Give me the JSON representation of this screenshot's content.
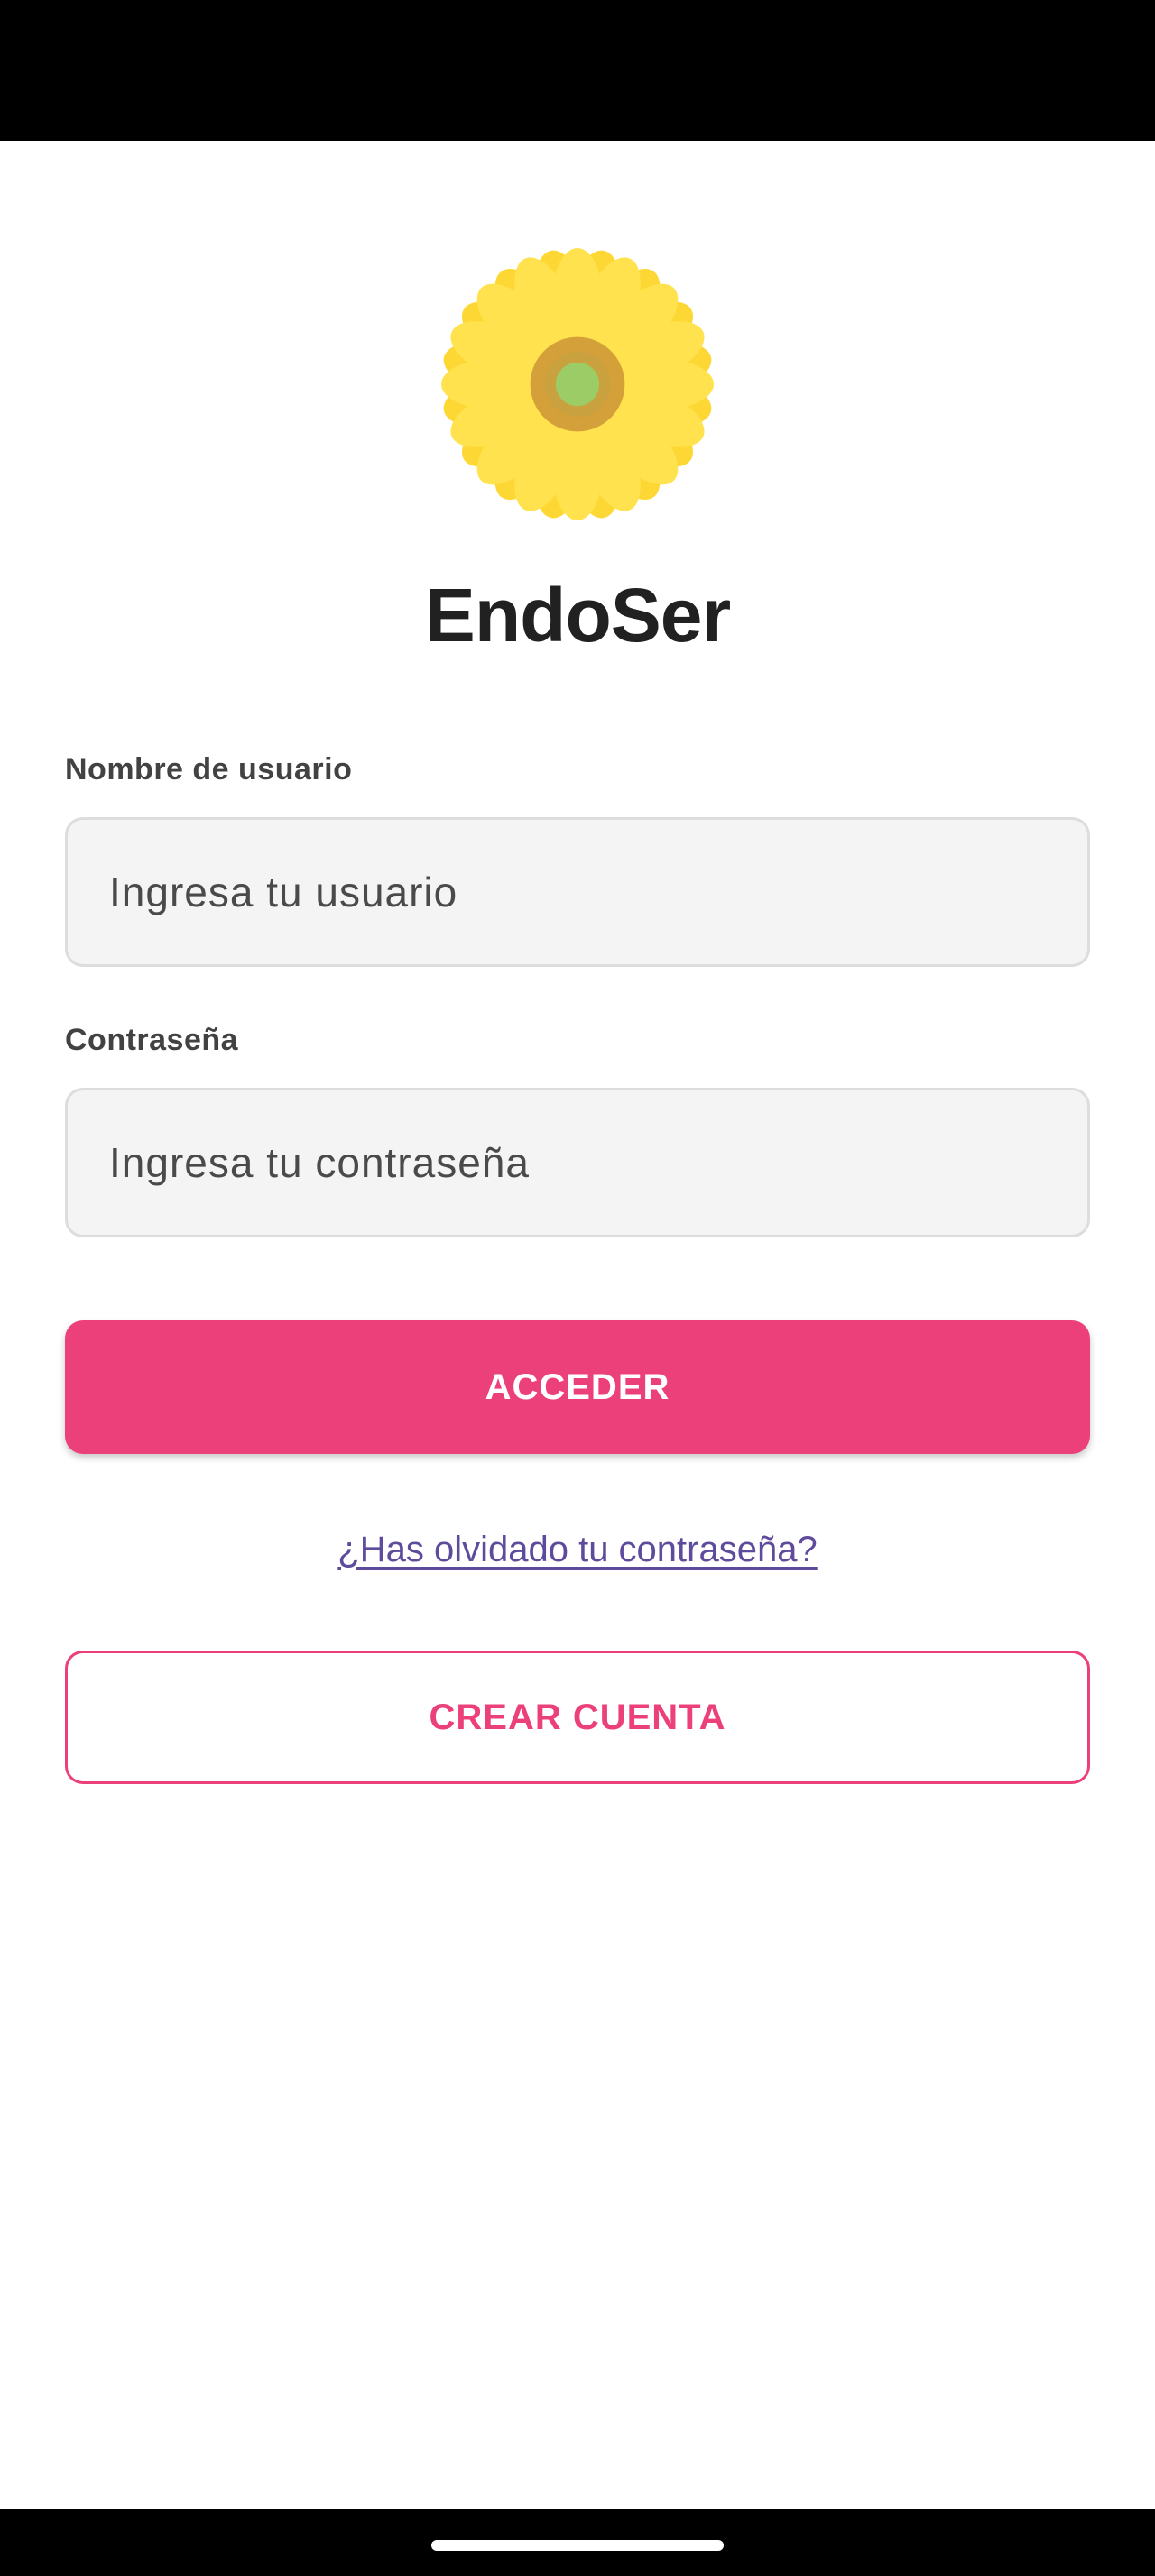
{
  "app": {
    "title": "EndoSer",
    "logo_icon": "sunflower-icon"
  },
  "form": {
    "username": {
      "label": "Nombre de usuario",
      "placeholder": "Ingresa tu usuario",
      "value": ""
    },
    "password": {
      "label": "Contraseña",
      "placeholder": "Ingresa tu contraseña",
      "value": ""
    },
    "login_label": "ACCEDER",
    "forgot_label": "¿Has olvidado tu contraseña?",
    "create_account_label": "CREAR CUENTA"
  },
  "colors": {
    "primary": "#ec407a",
    "link": "#5e4b9c",
    "petal": "#fdd835",
    "petal_light": "#ffe24d",
    "center_ring": "#d4a03a",
    "center": "#9ccc65"
  }
}
